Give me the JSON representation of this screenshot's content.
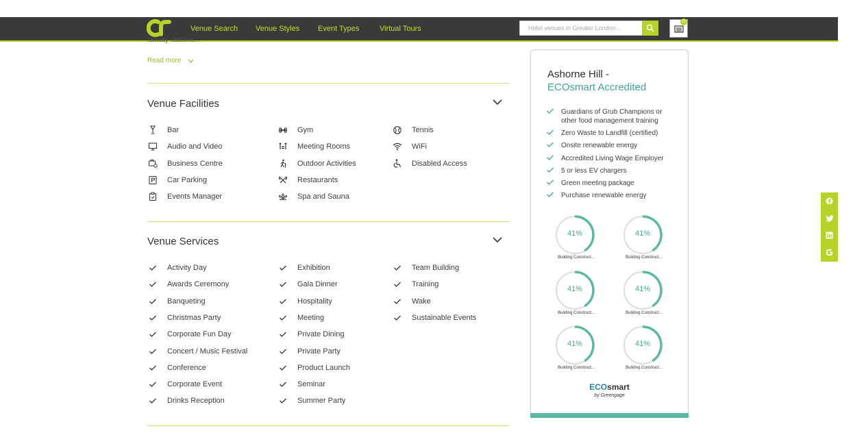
{
  "nav": {
    "links": [
      "Venue Search",
      "Venue Styles",
      "Event Types",
      "Virtual Tours"
    ],
    "search_placeholder": "Hotel venues in Greater London...",
    "cart_count": "0"
  },
  "intro": {
    "cut_text": "railway stations...",
    "read_more": "Read more"
  },
  "facilities": {
    "title": "Venue Facilities",
    "col1": [
      {
        "label": "Bar",
        "icon": "bar-icon"
      },
      {
        "label": "Audio and Video",
        "icon": "monitor-icon"
      },
      {
        "label": "Business Centre",
        "icon": "business-icon"
      },
      {
        "label": "Car Parking",
        "icon": "parking-icon"
      },
      {
        "label": "Events Manager",
        "icon": "clipboard-icon"
      }
    ],
    "col2": [
      {
        "label": "Gym",
        "icon": "dumbbell-icon"
      },
      {
        "label": "Meeting Rooms",
        "icon": "meeting-icon"
      },
      {
        "label": "Outdoor Activities",
        "icon": "hiker-icon"
      },
      {
        "label": "Restaurants",
        "icon": "cutlery-icon"
      },
      {
        "label": "Spa and Sauna",
        "icon": "lotus-icon"
      }
    ],
    "col3": [
      {
        "label": "Tennis",
        "icon": "tennis-icon"
      },
      {
        "label": "WiFi",
        "icon": "wifi-icon"
      },
      {
        "label": "Disabled Access",
        "icon": "wheelchair-icon"
      }
    ]
  },
  "services": {
    "title": "Venue Services",
    "col1": [
      "Activity Day",
      "Awards Ceremony",
      "Banqueting",
      "Christmas Party",
      "Corporate Fun Day",
      "Concert / Music Festival",
      "Conference",
      "Corporate Event",
      "Drinks Reception"
    ],
    "col2": [
      "Exhibition",
      "Gala Dinner",
      "Hospitality",
      "Meeting",
      "Private Dining",
      "Private Party",
      "Product Launch",
      "Seminar",
      "Summer Party"
    ],
    "col3": [
      "Team Building",
      "Training",
      "Wake",
      "Sustainable Events"
    ]
  },
  "eco": {
    "title_line1": "Ashorne Hill -",
    "title_line2": "ECOsmart Accredited",
    "items": [
      "Guardians of Grub Champions or other food management training",
      "Zero Waste to Landfill (certified)",
      "Onsite renewable energy",
      "Accredited Living Wage Employer",
      "5 or less EV chargers",
      "Green meeting package",
      "Purchase renewable energy"
    ],
    "gauges": [
      {
        "value": "41%",
        "fraction": 0.41,
        "label": "Building Construct..."
      },
      {
        "value": "41%",
        "fraction": 0.41,
        "label": "Building Construct..."
      },
      {
        "value": "41%",
        "fraction": 0.41,
        "label": "Building Construct..."
      },
      {
        "value": "41%",
        "fraction": 0.41,
        "label": "Building Construct..."
      },
      {
        "value": "41%",
        "fraction": 0.41,
        "label": "Building Construct..."
      },
      {
        "value": "41%",
        "fraction": 0.41,
        "label": "Building Construct..."
      }
    ],
    "logo_eco": "ECO",
    "logo_smart": "smart",
    "logo_by": "by Greengage"
  },
  "social": [
    "facebook-icon",
    "twitter-icon",
    "linkedin-icon",
    "google-icon"
  ],
  "colors": {
    "accent": "#b8d22a",
    "teal": "#3fa596",
    "nav_bg": "#3a3a3a"
  }
}
